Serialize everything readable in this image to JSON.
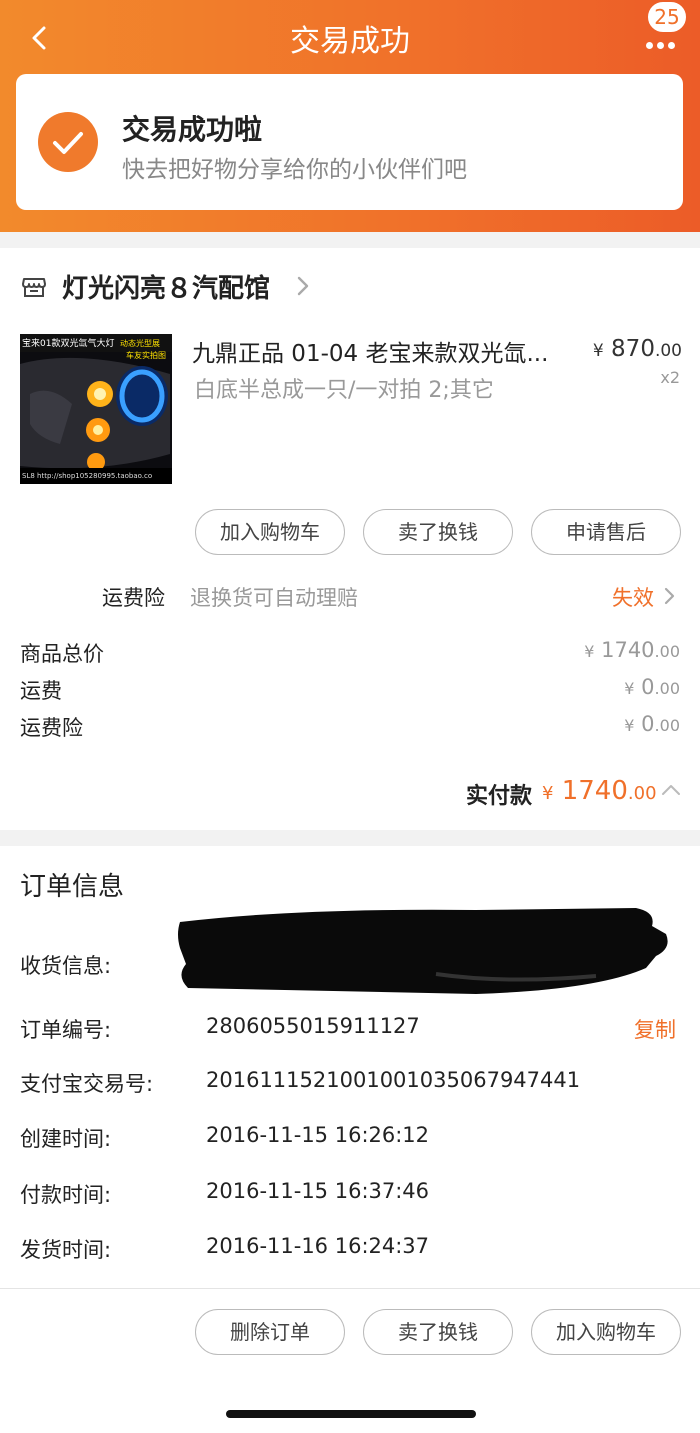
{
  "header": {
    "title": "交易成功",
    "badge_count": "25",
    "accent": "#f0702a"
  },
  "status": {
    "title": "交易成功啦",
    "subtitle": "快去把好物分享给你的小伙伴们吧"
  },
  "shop": {
    "name": "灯光闪亮８汽配馆"
  },
  "product": {
    "title": "九鼎正品 01-04 老宝来款双光氙...",
    "spec": "白底半总成一只/一对拍 2;其它",
    "price_symbol": "¥",
    "price_int": "870",
    "price_dec": ".00",
    "qty": "x2",
    "image_text_top": "宝来01款双光氙气大灯",
    "image_text_badge": "动态光型展",
    "image_text_badge2": "车友实拍图",
    "image_text_bottom": "SL8 http://shop105280995.taobao.co"
  },
  "product_actions": {
    "add_cart": "加入购物车",
    "resell": "卖了换钱",
    "after_sale": "申请售后"
  },
  "insurance": {
    "label": "运费险",
    "desc": "退换货可自动理赔",
    "status": "失效"
  },
  "costs": [
    {
      "label": "商品总价",
      "symbol": "¥",
      "int": "1740",
      "dec": ".00"
    },
    {
      "label": "运费",
      "symbol": "¥",
      "int": "0",
      "dec": ".00"
    },
    {
      "label": "运费险",
      "symbol": "¥",
      "int": "0",
      "dec": ".00"
    }
  ],
  "paid": {
    "label": "实付款",
    "symbol": "¥",
    "int": "1740",
    "dec": ".00"
  },
  "order_info": {
    "title": "订单信息",
    "shipping_label": "收货信息:",
    "order_no_label": "订单编号:",
    "order_no": "2806055015911127",
    "copy": "复制",
    "alipay_label": "支付宝交易号:",
    "alipay_no": "2016111521001001035067947441",
    "created_label": "创建时间:",
    "created": "2016-11-15 16:26:12",
    "paid_label": "付款时间:",
    "paid_time": "2016-11-15 16:37:46",
    "shipped_label": "发货时间:",
    "shipped": "2016-11-16 16:24:37"
  },
  "bottom_actions": {
    "delete": "删除订单",
    "resell": "卖了换钱",
    "add_cart": "加入购物车"
  }
}
